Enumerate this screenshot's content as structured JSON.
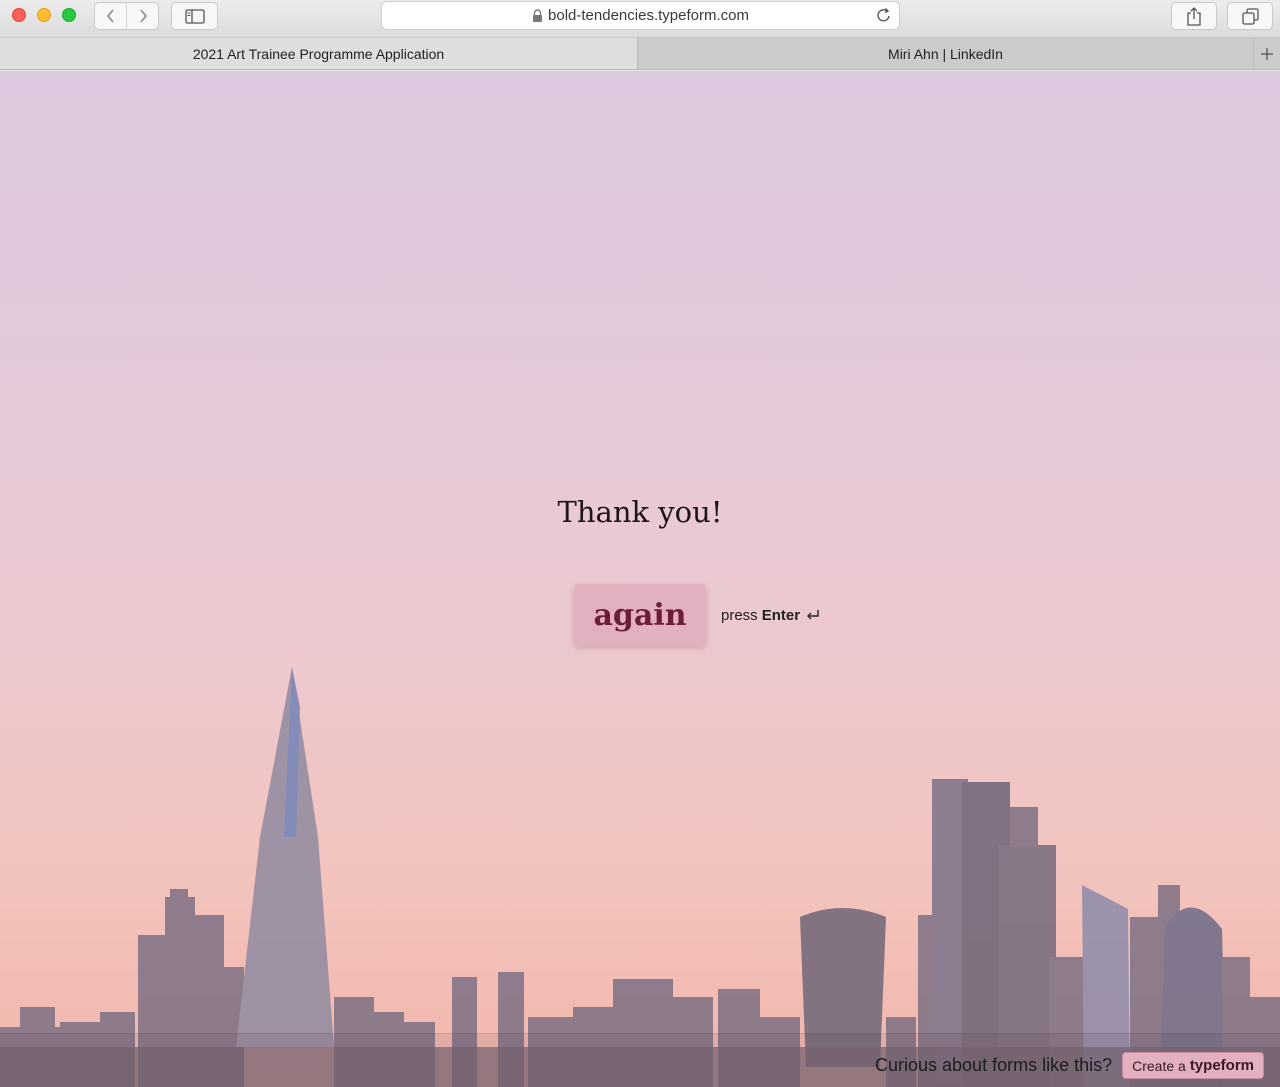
{
  "browser": {
    "url": "bold-tendencies.typeform.com",
    "tabs": [
      {
        "title": "2021 Art Trainee Programme Application",
        "active": true
      },
      {
        "title": "Miri Ahn | LinkedIn",
        "active": false
      }
    ],
    "icons": {
      "back": "chevron-left-icon",
      "forward": "chevron-right-icon",
      "sidebar": "sidebar-icon",
      "lock": "lock-icon",
      "reload": "reload-icon",
      "share": "share-icon",
      "tabs": "tab-overview-icon",
      "new_tab": "plus-icon"
    }
  },
  "page": {
    "heading": "Thank you!",
    "again_button": "again",
    "hint_prefix": "press",
    "hint_key": "Enter",
    "footer_question": "Curious about forms like this?",
    "create_prefix": "Create a",
    "create_brand": "typeform"
  },
  "colors": {
    "accent_button_bg": "#e3b0c0",
    "accent_button_text": "#6b1d3a",
    "sky_top": "#dcc8df",
    "sky_bottom": "#f1b6ac"
  }
}
